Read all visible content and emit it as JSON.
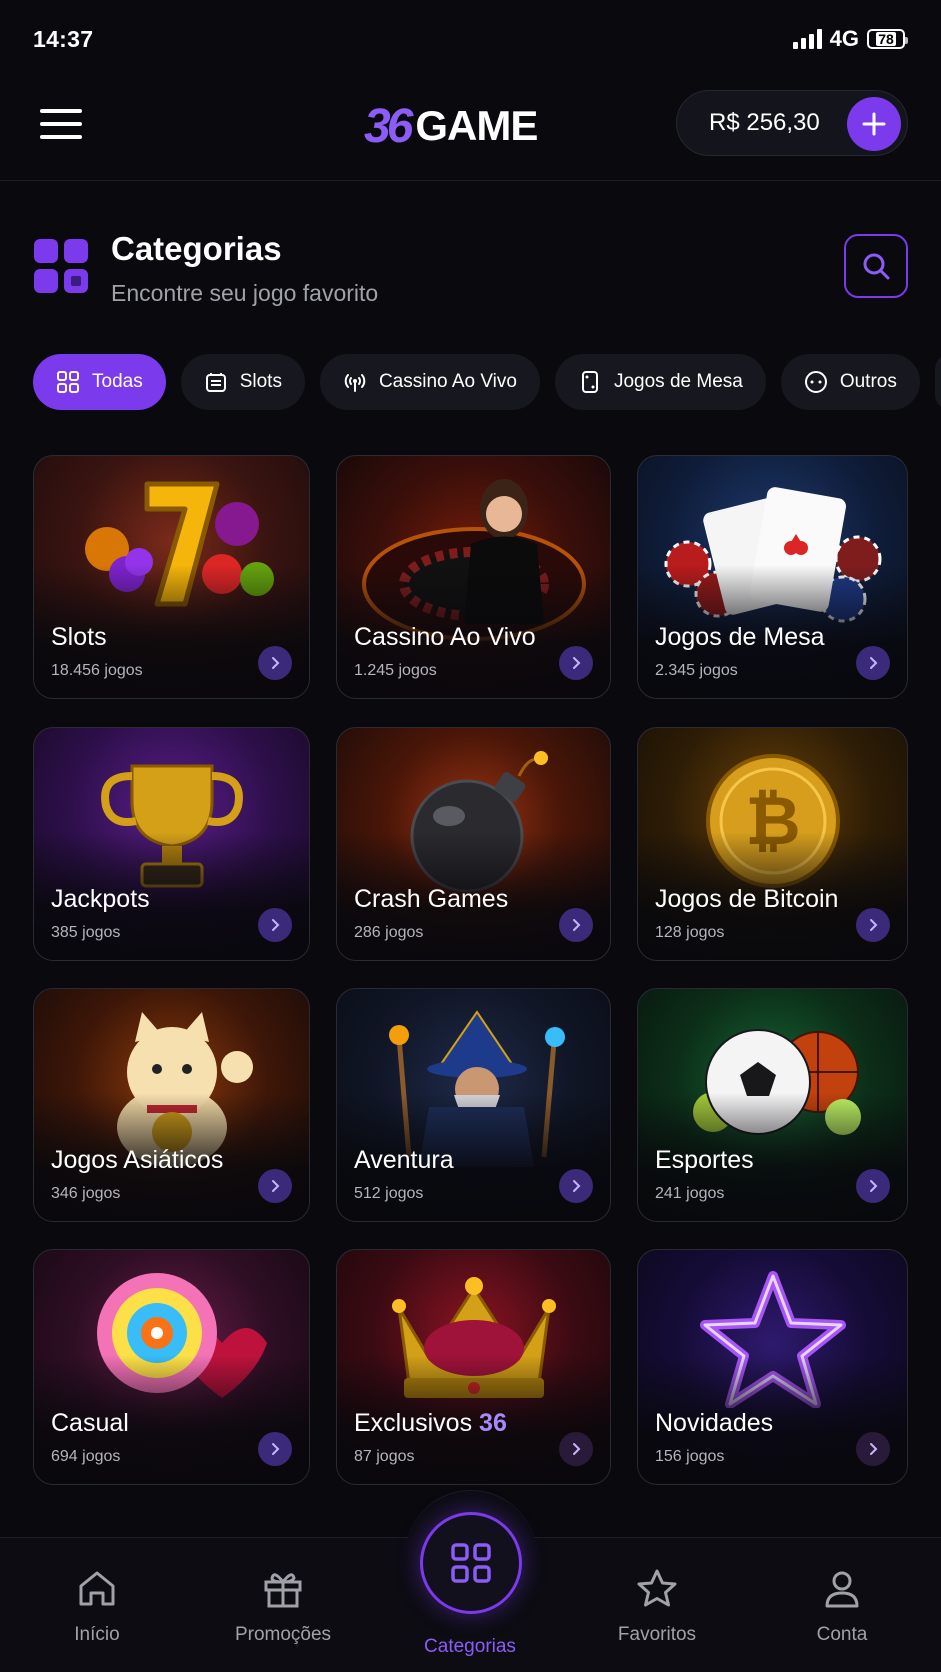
{
  "status": {
    "time": "14:37",
    "network": "4G",
    "battery": "78"
  },
  "header": {
    "logo_num": "36",
    "logo_text": "GAME",
    "balance": "R$ 256,30"
  },
  "section": {
    "title": "Categorias",
    "subtitle": "Encontre seu jogo favorito"
  },
  "chips": [
    {
      "label": "Todas",
      "icon": "grid-icon",
      "active": true
    },
    {
      "label": "Slots",
      "icon": "slot-machine-icon"
    },
    {
      "label": "Cassino Ao Vivo",
      "icon": "broadcast-icon"
    },
    {
      "label": "Jogos de Mesa",
      "icon": "card-icon"
    },
    {
      "label": "Outros",
      "icon": "more-icon"
    }
  ],
  "cards": [
    {
      "name": "Slots",
      "count": "18.456 jogos",
      "icon": "lucky-seven-icon"
    },
    {
      "name": "Cassino Ao Vivo",
      "count": "1.245 jogos",
      "icon": "live-dealer-icon"
    },
    {
      "name": "Jogos de Mesa",
      "count": "2.345 jogos",
      "icon": "playing-cards-icon"
    },
    {
      "name": "Jackpots",
      "count": "385 jogos",
      "icon": "trophy-icon"
    },
    {
      "name": "Crash Games",
      "count": "286 jogos",
      "icon": "bomb-icon"
    },
    {
      "name": "Jogos de Bitcoin",
      "count": "128 jogos",
      "icon": "bitcoin-icon"
    },
    {
      "name": "Jogos Asiáticos",
      "count": "346 jogos",
      "icon": "lucky-cat-icon"
    },
    {
      "name": "Aventura",
      "count": "512 jogos",
      "icon": "wizard-icon"
    },
    {
      "name": "Esportes",
      "count": "241 jogos",
      "icon": "sports-balls-icon"
    },
    {
      "name": "Casual",
      "count": "694 jogos",
      "icon": "lollipop-icon"
    },
    {
      "name": "Exclusivos",
      "name_highlight": "36",
      "count": "87 jogos",
      "icon": "crown-icon"
    },
    {
      "name": "Novidades",
      "count": "156 jogos",
      "icon": "star-icon"
    }
  ],
  "nav": {
    "home": "Início",
    "promos": "Promoções",
    "categories": "Categorias",
    "favorites": "Favoritos",
    "account": "Conta"
  },
  "colors": {
    "accent": "#7c3aed",
    "accent_light": "#8b5cf6",
    "background": "#09090e"
  }
}
